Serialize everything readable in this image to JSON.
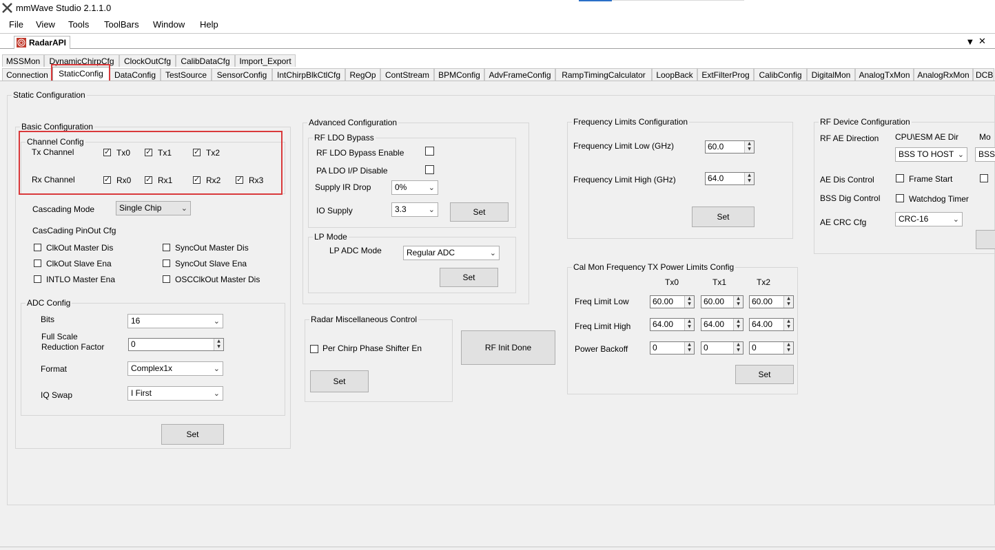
{
  "window": {
    "title": "mmWave Studio 2.1.1.0"
  },
  "menu": [
    "File",
    "View",
    "Tools",
    "ToolBars",
    "Window",
    "Help"
  ],
  "dock": {
    "tab_label": "RadarAPI",
    "pin_glyph": "▼",
    "close_glyph": "✕"
  },
  "tabs_row1": [
    "MSSMon",
    "DynamicChirpCfg",
    "ClockOutCfg",
    "CalibDataCfg",
    "Import_Export"
  ],
  "tabs_row2": [
    "Connection",
    "StaticConfig",
    "DataConfig",
    "TestSource",
    "SensorConfig",
    "IntChirpBlkCtlCfg",
    "RegOp",
    "ContStream",
    "BPMConfig",
    "AdvFrameConfig",
    "RampTimingCalculator",
    "LoopBack",
    "ExtFilterProg",
    "CalibConfig",
    "DigitalMon",
    "AnalogTxMon",
    "AnalogRxMon",
    "DCB"
  ],
  "static": {
    "title": "Static Configuration",
    "basic": {
      "title": "Basic Configuration",
      "channel": {
        "title": "Channel Config",
        "tx_label": "Tx Channel",
        "rx_label": "Rx Channel",
        "tx": [
          "Tx0",
          "Tx1",
          "Tx2"
        ],
        "rx": [
          "Rx0",
          "Rx1",
          "Rx2",
          "Rx3"
        ]
      },
      "cascading_label": "Cascading Mode",
      "cascading_value": "Single Chip",
      "pinout_label": "CasCading PinOut Cfg",
      "pinout": [
        "ClkOut Master Dis",
        "SyncOut Master Dis",
        "ClkOut Slave Ena",
        "SyncOut Slave Ena",
        "INTLO Master Ena",
        "OSCClkOut Master Dis"
      ],
      "adc": {
        "title": "ADC Config",
        "bits_label": "Bits",
        "bits_value": "16",
        "fs_label1": "Full Scale",
        "fs_label2": "Reduction Factor",
        "fs_value": "0",
        "format_label": "Format",
        "format_value": "Complex1x",
        "iq_label": "IQ Swap",
        "iq_value": "I First"
      },
      "set": "Set"
    },
    "advanced": {
      "title": "Advanced Configuration",
      "ldo_title": "RF LDO Bypass",
      "ldo_enable": "RF LDO Bypass Enable",
      "pa_ldo": "PA LDO I/P Disable",
      "supply_ir_label": "Supply IR Drop",
      "supply_ir_value": "0%",
      "io_supply_label": "IO Supply",
      "io_supply_value": "3.3",
      "set": "Set",
      "lp_title": "LP Mode",
      "lp_adc_label": "LP ADC Mode",
      "lp_adc_value": "Regular ADC",
      "lp_set": "Set"
    },
    "misc": {
      "title": "Radar Miscellaneous Control",
      "per_chirp": "Per Chirp Phase Shifter En",
      "set": "Set"
    },
    "rf_init": "RF Init Done",
    "freq": {
      "title": "Frequency Limits Configuration",
      "low_label": "Frequency Limit Low (GHz)",
      "low_value": "60.0",
      "high_label": "Frequency Limit High (GHz)",
      "high_value": "64.0",
      "set": "Set"
    },
    "calmon": {
      "title": "Cal Mon Frequency TX Power Limits Config",
      "cols": [
        "Tx0",
        "Tx1",
        "Tx2"
      ],
      "rows": [
        {
          "label": "Freq Limit Low",
          "values": [
            "60.00",
            "60.00",
            "60.00"
          ]
        },
        {
          "label": "Freq Limit High",
          "values": [
            "64.00",
            "64.00",
            "64.00"
          ]
        },
        {
          "label": "Power Backoff",
          "values": [
            "0",
            "0",
            "0"
          ]
        }
      ],
      "set": "Set"
    },
    "rfdev": {
      "title": "RF Device Configuration",
      "ae_dir_label": "RF AE Direction",
      "cpu_esm_label": "CPU\\ESM AE Dir",
      "mo_label": "Mo",
      "ae_dir_value": "BSS TO HOST",
      "ae_dir_value2": "BSS",
      "ae_dis_label": "AE Dis Control",
      "frame_start": "Frame Start",
      "bss_dig_label": "BSS Dig Control",
      "watchdog": "Watchdog Timer",
      "ae_crc_label": "AE CRC Cfg",
      "ae_crc_value": "CRC-16"
    }
  }
}
